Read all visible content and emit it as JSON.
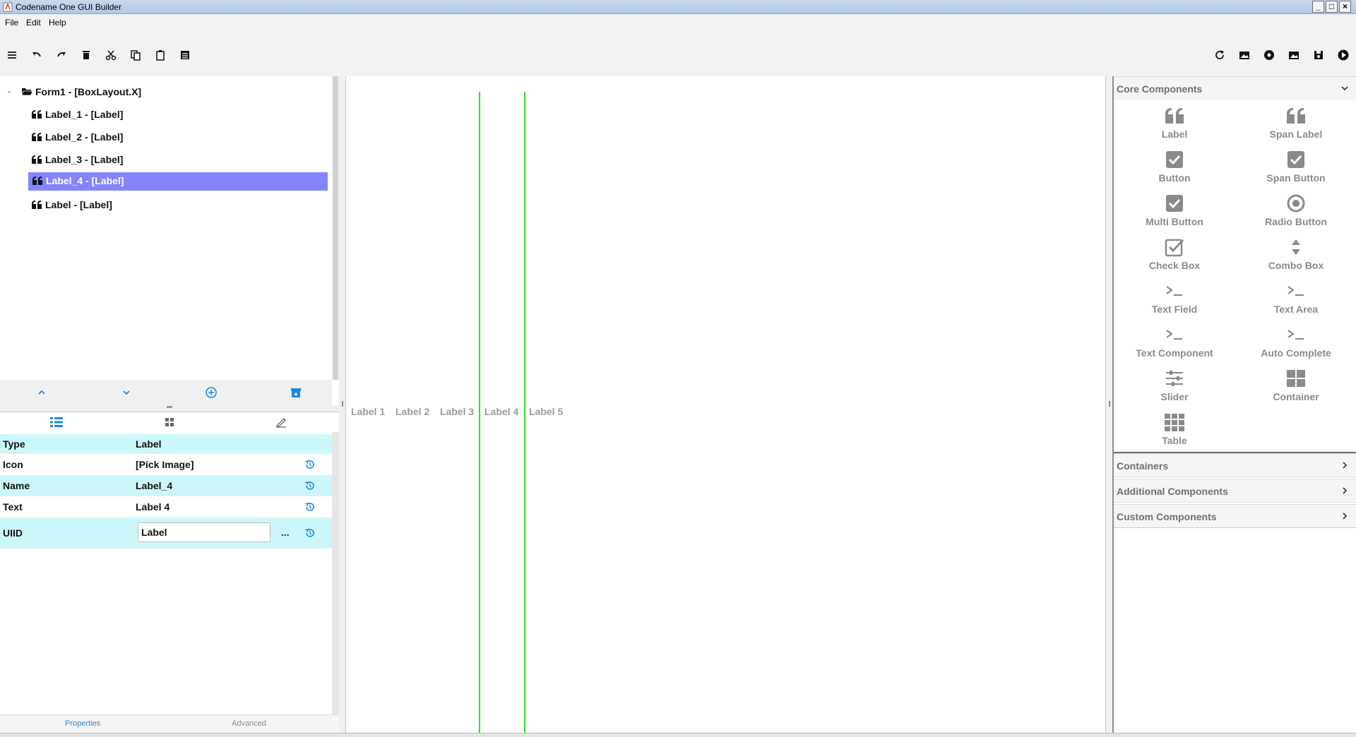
{
  "window": {
    "title": "Codename One GUI Builder",
    "minimize": "_",
    "maximize": "□",
    "close": "×"
  },
  "menu": {
    "file": "File",
    "edit": "Edit",
    "help": "Help"
  },
  "toolbar": {
    "left_icons": [
      "hamburger-icon",
      "undo-icon",
      "redo-icon",
      "trash-icon",
      "cut-icon",
      "copy-icon",
      "paste-icon",
      "list-icon"
    ],
    "right_icons": [
      "refresh-icon",
      "image-icon",
      "radio-icon",
      "image-alt-icon",
      "save-icon",
      "play-icon"
    ]
  },
  "tree": {
    "collapse": "-",
    "root": "Form1 - [BoxLayout.X]",
    "items": [
      {
        "label": "Label_1 - [Label]"
      },
      {
        "label": "Label_2 - [Label]"
      },
      {
        "label": "Label_3 - [Label]"
      },
      {
        "label": "Label_4 - [Label]",
        "selected": true
      },
      {
        "label": "Label - [Label]"
      }
    ]
  },
  "properties": {
    "rows": [
      {
        "key": "Type",
        "value": "Label"
      },
      {
        "key": "Icon",
        "value": "[Pick Image]"
      },
      {
        "key": "Name",
        "value": "Label_4"
      },
      {
        "key": "Text",
        "value": "Label 4"
      },
      {
        "key": "UIID",
        "value": "Label"
      }
    ],
    "uiid_more": "...",
    "tabs": {
      "properties": "Properties",
      "advanced": "Advanced"
    }
  },
  "canvas": {
    "labels": [
      "Label 1",
      "Label 2",
      "Label 3",
      "Label 4",
      "Label 5"
    ]
  },
  "palette": {
    "core_title": "Core Components",
    "core_items": [
      {
        "label": "Label",
        "icon": "quote-icon"
      },
      {
        "label": "Span Label",
        "icon": "quote-icon"
      },
      {
        "label": "Button",
        "icon": "checkbox-icon"
      },
      {
        "label": "Span Button",
        "icon": "checkbox-icon"
      },
      {
        "label": "Multi Button",
        "icon": "checkbox-icon"
      },
      {
        "label": "Radio Button",
        "icon": "radio-icon"
      },
      {
        "label": "Check Box",
        "icon": "check-outline-icon"
      },
      {
        "label": "Combo Box",
        "icon": "updown-icon"
      },
      {
        "label": "Text Field",
        "icon": "prompt-icon"
      },
      {
        "label": "Text Area",
        "icon": "prompt-icon"
      },
      {
        "label": "Text Component",
        "icon": "prompt-icon"
      },
      {
        "label": "Auto Complete",
        "icon": "prompt-icon"
      },
      {
        "label": "Slider",
        "icon": "slider-icon"
      },
      {
        "label": "Container",
        "icon": "grid-icon"
      },
      {
        "label": "Table",
        "icon": "table-icon"
      }
    ],
    "sections": [
      {
        "label": "Containers"
      },
      {
        "label": "Additional Components"
      },
      {
        "label": "Custom Components"
      }
    ]
  },
  "colors": {
    "selection": "#8484ff",
    "accent": "#1e88e5",
    "property_alt_row": "#ccf7fa",
    "guide_line": "#2fdf2f"
  }
}
